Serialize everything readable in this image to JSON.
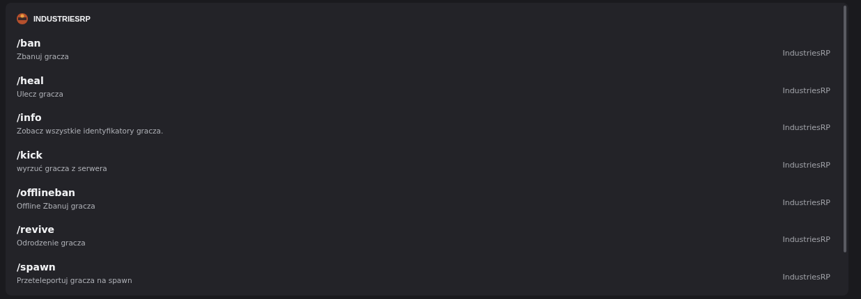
{
  "header": {
    "title": "INDUSTRIESRP"
  },
  "commands": [
    {
      "name": "/ban",
      "description": "Zbanuj gracza",
      "source": "IndustriesRP"
    },
    {
      "name": "/heal",
      "description": "Ulecz gracza",
      "source": "IndustriesRP"
    },
    {
      "name": "/info",
      "description": "Zobacz wszystkie identyfikatory gracza.",
      "source": "IndustriesRP"
    },
    {
      "name": "/kick",
      "description": "wyrzuć gracza z serwera",
      "source": "IndustriesRP"
    },
    {
      "name": "/offlineban",
      "description": "Offline Zbanuj gracza",
      "source": "IndustriesRP"
    },
    {
      "name": "/revive",
      "description": "Odrodzenie gracza",
      "source": "IndustriesRP"
    },
    {
      "name": "/spawn",
      "description": "Przeteleportuj gracza na spawn",
      "source": "IndustriesRP"
    }
  ]
}
